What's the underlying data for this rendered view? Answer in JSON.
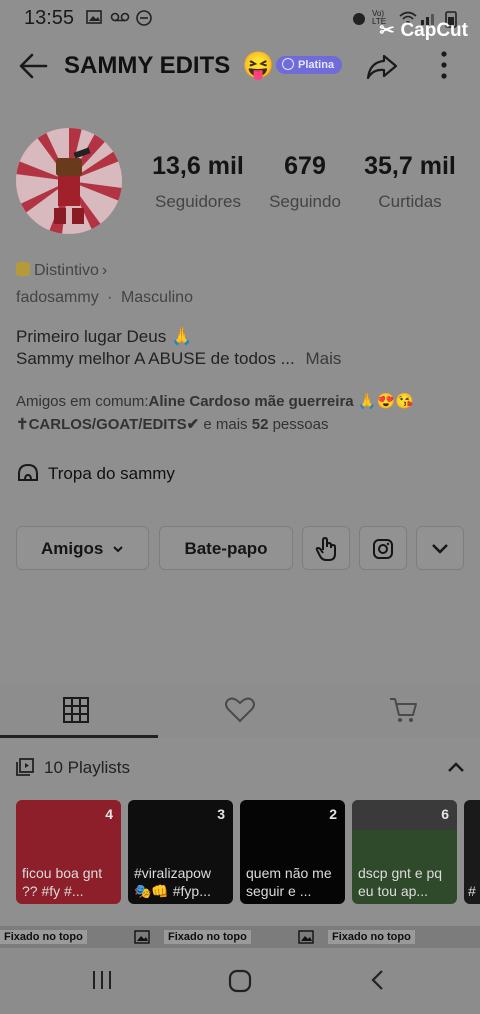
{
  "status": {
    "time": "13:55"
  },
  "overlay": {
    "app_name": "CapCut"
  },
  "header": {
    "title": "SAMMY EDITS",
    "emoji": "😝",
    "tier_badge": "Platina"
  },
  "stats": [
    {
      "value": "13,6 mil",
      "label": "Seguidores"
    },
    {
      "value": "679",
      "label": "Seguindo"
    },
    {
      "value": "35,7 mil",
      "label": "Curtidas"
    }
  ],
  "profile": {
    "badge_label": "Distintivo",
    "badge_chevron": "›",
    "handle": "fadosammy",
    "separator": "·",
    "gender": "Masculino",
    "bio_line1": "Primeiro lugar Deus 🙏",
    "bio_line2": "Sammy melhor A ABUSE de todos ...",
    "bio_more": "Mais",
    "mutual_prefix": "Amigos em comum:",
    "mutual_name1": "Aline Cardoso mãe guerreira 🙏😍😘",
    "mutual_name2": "✝CARLOS/GOAT/EDITS✔",
    "mutual_more_prefix": "e mais",
    "mutual_more_count": "52",
    "mutual_more_suffix": "pessoas",
    "group_name": "Tropa do sammy"
  },
  "actions": {
    "friends_label": "Amigos",
    "chat_label": "Bate-papo"
  },
  "playlists": {
    "header": "10 Playlists",
    "items": [
      {
        "count": "4",
        "title": "ficou boa gnt ?? #fy #...",
        "color": "#8c1f2a"
      },
      {
        "count": "3",
        "title": "#viralizapow 🎭👊 #fyp...",
        "color": "#0e0e0e"
      },
      {
        "count": "2",
        "title": "quem não me seguir e ...",
        "color": "#050505"
      },
      {
        "count": "6",
        "title": "dscp gnt e pq eu tou ap...",
        "color": "#2f4a2a"
      },
      {
        "count": "",
        "title": "#",
        "color": "#1a1a1a"
      }
    ]
  },
  "pinned": {
    "label": "Fixado no topo"
  }
}
